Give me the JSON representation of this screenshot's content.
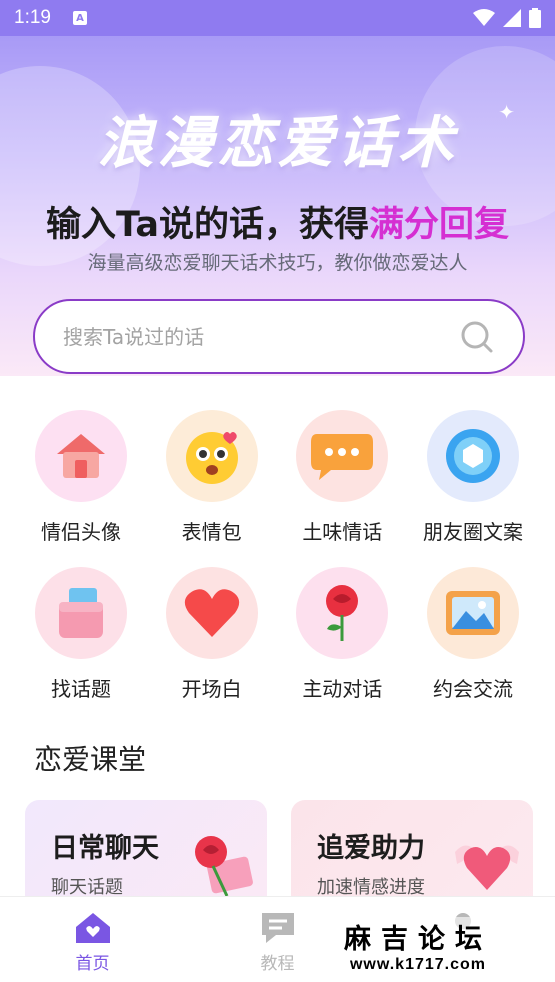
{
  "status_bar": {
    "time": "1:19",
    "badge": "A"
  },
  "hero": {
    "title": "浪漫恋爱话术",
    "subtitle_prefix": "输入Ta说的话，获得",
    "subtitle_accent": "满分回复",
    "description": "海量高级恋爱聊天话术技巧，教你做恋爱达人"
  },
  "search": {
    "placeholder": "搜索Ta说过的话"
  },
  "categories": [
    {
      "label": "情侣头像",
      "icon": "house-icon",
      "bg": "#fde0f2"
    },
    {
      "label": "表情包",
      "icon": "emoji-icon",
      "bg": "#fdecd8"
    },
    {
      "label": "土味情话",
      "icon": "chat-bubble-icon",
      "bg": "#fde3e1"
    },
    {
      "label": "朋友圈文案",
      "icon": "aperture-icon",
      "bg": "#e3eafc"
    },
    {
      "label": "找话题",
      "icon": "wallet-icon",
      "bg": "#fde0e8"
    },
    {
      "label": "开场白",
      "icon": "heart-icon",
      "bg": "#fde2e2"
    },
    {
      "label": "主动对话",
      "icon": "rose-icon",
      "bg": "#fde0ee"
    },
    {
      "label": "约会交流",
      "icon": "picture-icon",
      "bg": "#fde9d8"
    }
  ],
  "section": {
    "title": "恋爱课堂"
  },
  "cards": [
    {
      "title": "日常聊天",
      "subtitle": "聊天话题"
    },
    {
      "title": "追爱助力",
      "subtitle": "加速情感进度"
    }
  ],
  "nav": [
    {
      "label": "首页",
      "active": true
    },
    {
      "label": "教程",
      "active": false
    }
  ],
  "watermark": {
    "top": "麻吉论坛",
    "bottom": "www.k1717.com"
  },
  "colors": {
    "accent": "#d52fd2",
    "search_border": "#8a3bc7",
    "nav_active": "#7a56e3"
  }
}
